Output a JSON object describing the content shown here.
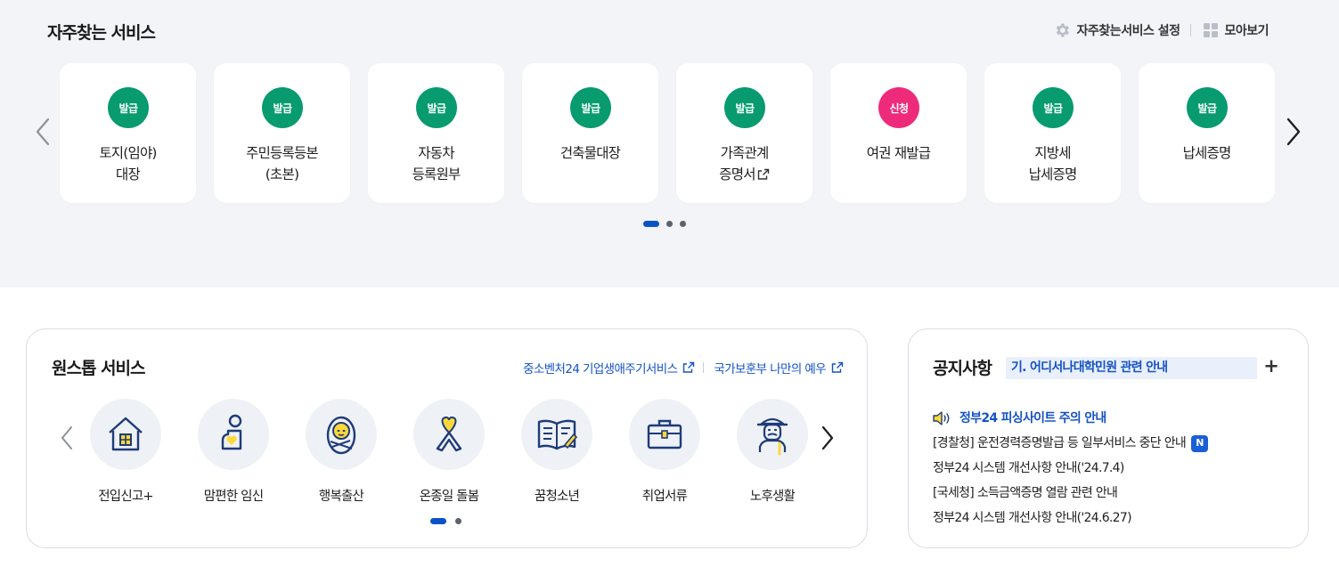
{
  "frequent": {
    "title": "자주찾는 서비스",
    "settings_label": "자주찾는서비스 설정",
    "viewall_label": "모아보기",
    "cards": [
      {
        "badge": "발급",
        "badge_color": "#079b6f",
        "lines": [
          "토지(임야)",
          "대장"
        ],
        "external": false
      },
      {
        "badge": "발급",
        "badge_color": "#079b6f",
        "lines": [
          "주민등록등본",
          "(초본)"
        ],
        "external": false
      },
      {
        "badge": "발급",
        "badge_color": "#079b6f",
        "lines": [
          "자동차",
          "등록원부"
        ],
        "external": false
      },
      {
        "badge": "발급",
        "badge_color": "#079b6f",
        "lines": [
          "건축물대장"
        ],
        "external": false
      },
      {
        "badge": "발급",
        "badge_color": "#079b6f",
        "lines": [
          "가족관계",
          "증명서"
        ],
        "external": true
      },
      {
        "badge": "신청",
        "badge_color": "#ee2b7b",
        "lines": [
          "여권 재발급"
        ],
        "external": false
      },
      {
        "badge": "발급",
        "badge_color": "#079b6f",
        "lines": [
          "지방세",
          "납세증명"
        ],
        "external": false
      },
      {
        "badge": "발급",
        "badge_color": "#079b6f",
        "lines": [
          "납세증명"
        ],
        "external": false
      }
    ],
    "page_count": 3,
    "active_page": 1
  },
  "onestop": {
    "title": "원스톱 서비스",
    "link1": "중소벤처24 기업생애주기서비스",
    "link2": "국가보훈부 나만의 예우",
    "services": [
      {
        "label": "전입신고+",
        "icon": "house-icon"
      },
      {
        "label": "맘편한 임신",
        "icon": "pregnancy-icon"
      },
      {
        "label": "행복출산",
        "icon": "baby-icon"
      },
      {
        "label": "온종일 돌봄",
        "icon": "care-ribbon-icon"
      },
      {
        "label": "꿈청소년",
        "icon": "book-icon"
      },
      {
        "label": "취업서류",
        "icon": "briefcase-icon"
      },
      {
        "label": "노후생활",
        "icon": "elder-icon"
      }
    ],
    "page_count": 2,
    "active_page": 1
  },
  "notice": {
    "title": "공지사항",
    "ticker": "기. 어디서나대학민원 관련 안내",
    "plus_label": "+",
    "items": [
      {
        "text": "정부24 피싱사이트 주의 안내",
        "highlight": true,
        "new": false
      },
      {
        "text": "[경찰청] 운전경력증명발급 등 일부서비스 중단 안내",
        "highlight": false,
        "new": true
      },
      {
        "text": "정부24 시스템 개선사항 안내('24.7.4)",
        "highlight": false,
        "new": false
      },
      {
        "text": "[국세청] 소득금액증명 열람 관련 안내",
        "highlight": false,
        "new": false
      },
      {
        "text": "정부24 시스템 개선사항 안내('24.6.27)",
        "highlight": false,
        "new": false
      }
    ],
    "new_badge": "N"
  },
  "colors": {
    "accent_blue": "#1552c2",
    "issue_green": "#079b6f",
    "apply_pink": "#ee2b7b",
    "icon_navy": "#1f3b78",
    "icon_yellow": "#ffd83a"
  }
}
